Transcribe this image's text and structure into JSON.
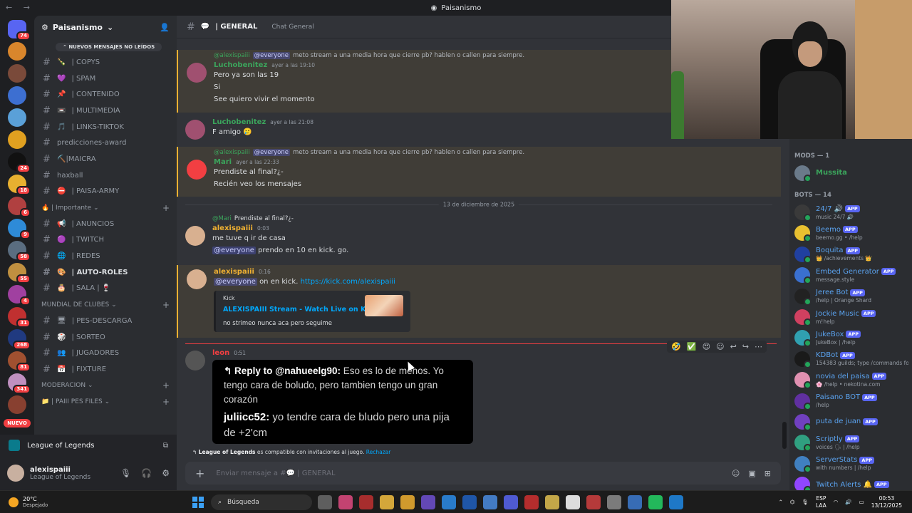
{
  "window": {
    "title": "Paisanismo"
  },
  "rail": {
    "servers": [
      {
        "color": "#5865f2",
        "badge": "74"
      },
      {
        "color": "#d9862c",
        "badge": ""
      },
      {
        "color": "#7a4a3a",
        "badge": ""
      },
      {
        "color": "#3d6fd1",
        "badge": ""
      },
      {
        "color": "#5aa0d8",
        "badge": ""
      },
      {
        "color": "#e0a020",
        "badge": ""
      },
      {
        "color": "#111111",
        "badge": "24"
      },
      {
        "color": "#e8b030",
        "badge": "18"
      },
      {
        "color": "#b04040",
        "badge": "6"
      },
      {
        "color": "#2e8bd8",
        "badge": "9"
      },
      {
        "color": "#5a6d80",
        "badge": "58"
      },
      {
        "color": "#c09040",
        "badge": "55"
      },
      {
        "color": "#a040a0",
        "badge": "4"
      },
      {
        "color": "#c03030",
        "badge": "31"
      },
      {
        "color": "#203a80",
        "badge": "268"
      },
      {
        "color": "#a05030",
        "badge": "81"
      },
      {
        "color": "#c090c0",
        "badge": "341"
      },
      {
        "color": "#884030",
        "badge": ""
      }
    ],
    "new_label": "NUEVO"
  },
  "sidebar": {
    "server_name": "Paisanismo",
    "new_messages": "NUEVOS MENSAJES NO LEÍDOS",
    "channels": [
      {
        "icon": "🍾",
        "name": "| COPYS",
        "hash": true
      },
      {
        "icon": "💜",
        "name": "| SPAM",
        "hash": true
      },
      {
        "icon": "📌",
        "name": "| CONTENIDO",
        "hash": true
      },
      {
        "icon": "📼",
        "name": "| MULTIMEDIA",
        "hash": true
      },
      {
        "icon": "🎵",
        "name": "| LINKS-TIKTOK",
        "hash": true
      },
      {
        "icon": "",
        "name": "predicciones-award",
        "hash": true
      },
      {
        "icon": "",
        "name": "⛏️|MAICRA",
        "hash": true
      },
      {
        "icon": "",
        "name": "haxball",
        "hash": true
      },
      {
        "icon": "⛔",
        "name": "| PAISA-ARMY",
        "hash": true
      }
    ],
    "cat_important": "| Importante",
    "important_channels": [
      {
        "icon": "📢",
        "name": "| ANUNCIOS"
      },
      {
        "icon": "🟣",
        "name": "| TWITCH"
      },
      {
        "icon": "🌐",
        "name": "| REDES"
      },
      {
        "icon": "🎨",
        "name": "| AUTO-ROLES"
      },
      {
        "icon": "🎂",
        "name": "| SALA | 🍷"
      }
    ],
    "cat_mundial": "MUNDIAL DE CLUBES",
    "mundial_channels": [
      {
        "icon": "🖥",
        "name": "| PES-DESCARGA"
      },
      {
        "icon": "🎲",
        "name": "| SORTEO"
      },
      {
        "icon": "👥",
        "name": "| JUGADORES"
      },
      {
        "icon": "📅",
        "name": "| FIXTURE"
      }
    ],
    "cat_moderacion": "MODERACION",
    "cat_files": "| PAIII PES FILES"
  },
  "voice": {
    "game": "League of Legends"
  },
  "user": {
    "name": "alexispaiii",
    "status": "League of Legends"
  },
  "chat": {
    "channel": "| GENERAL",
    "topic": "Chat General",
    "messages": {
      "m0": {
        "reply_user": "@alexispaiii",
        "reply_mention": "@everyone",
        "reply_text": "meto stream a una media hora que cierre pb? hablen o callen para siempre.",
        "user": "Luchobenitez",
        "time": "ayer a las 19:10",
        "l1": "Pero ya son las 19",
        "l2": "Si",
        "l3": "See quiero vivir el momento"
      },
      "m1": {
        "user": "Luchobenitez",
        "time": "ayer a las 21:08",
        "l1": "F amigo 🥲"
      },
      "m2": {
        "reply_user": "@alexispaiii",
        "reply_mention": "@everyone",
        "reply_text": "meto stream a una media hora que cierre pb? hablen o callen para siempre.",
        "user": "Mari",
        "time": "ayer a las 22:33",
        "l1": "Prendiste al final?¿-",
        "l2": "Recién veo los mensajes"
      },
      "date": "13 de diciembre de 2025",
      "m3": {
        "reply_user": "@Mari",
        "reply_text": "Prendiste al final?¿-",
        "user": "alexispaiii",
        "time": "0:03",
        "l1": "me tuve q ir de casa",
        "mention": "@everyone",
        "l2": "prendo en 10 en kick. go."
      },
      "m4": {
        "user": "alexispaiii",
        "time": "0:16",
        "mention": "@everyone",
        "l1": "on en kick.",
        "link": "https://kick.com/alexispaiii",
        "embed_provider": "Kick",
        "embed_title": "ALEXISPAIII Stream - Watch Live on Kick",
        "embed_desc": "no strimeo nunca aca pero seguime"
      },
      "m5": {
        "user": "leon",
        "time": "0:51",
        "reply_head": "↰ Reply to @nahueelg90:",
        "reply_body": "Eso es lo de menos. Yo tengo cara de boludo, pero tambien tengo un gran corazón",
        "second_user": "juliicc52:",
        "second_body": "yo tendre cara de bludo pero una pija de +2'cm"
      }
    },
    "invite_game": "League of Legends",
    "invite_text": "es compatible con invitaciones al juego.",
    "invite_reject": "Rechazar",
    "composer_placeholder": "Enviar mensaje a #💬 | GENERAL"
  },
  "members": {
    "mods_header": "MODS — 1",
    "mods": [
      {
        "name": "Mussita",
        "color": "#6a7a8a"
      }
    ],
    "bots_header": "BOTS — 14",
    "bots": [
      {
        "name": "24/7 🔊",
        "sub": "music 24/7 🔊",
        "color": "#3a3a3a"
      },
      {
        "name": "Beemo",
        "sub": "beemo.gg • /help",
        "color": "#e8c030"
      },
      {
        "name": "Boquita",
        "sub": "👑 /achievements 👑",
        "color": "#2040a0"
      },
      {
        "name": "Embed Generator",
        "sub": "message.style",
        "color": "#3a70d0"
      },
      {
        "name": "Jeree Bot",
        "sub": "/help | Orange Shard",
        "color": "#222222"
      },
      {
        "name": "Jockie Music",
        "sub": "m!help",
        "color": "#d04060"
      },
      {
        "name": "JukeBox",
        "sub": "JukeBox | /help",
        "color": "#30a0b0"
      },
      {
        "name": "KDBot",
        "sub": "154383 guilds; type /commands fo...",
        "color": "#1a1a1a"
      },
      {
        "name": "novia del paisa",
        "sub": "🌸 /help • nekotina.com",
        "color": "#e090b0"
      },
      {
        "name": "Paisano BOT",
        "sub": "/help",
        "color": "#6030a0"
      },
      {
        "name": "puta de juan",
        "sub": "",
        "color": "#7040c0"
      },
      {
        "name": "Scriptly",
        "sub": "voices 🗣 | /help",
        "color": "#30a080"
      },
      {
        "name": "ServerStats",
        "sub": "with numbers | /help",
        "color": "#4080c0"
      },
      {
        "name": "Twitch Alerts 🔔",
        "sub": "",
        "color": "#9146ff"
      }
    ],
    "app_tag": "APP"
  },
  "taskbar": {
    "temp": "20°C",
    "weather": "Despejado",
    "search": "Búsqueda",
    "lang1": "ESP",
    "lang2": "LAA",
    "time": "00:53",
    "date": "13/12/2025"
  }
}
